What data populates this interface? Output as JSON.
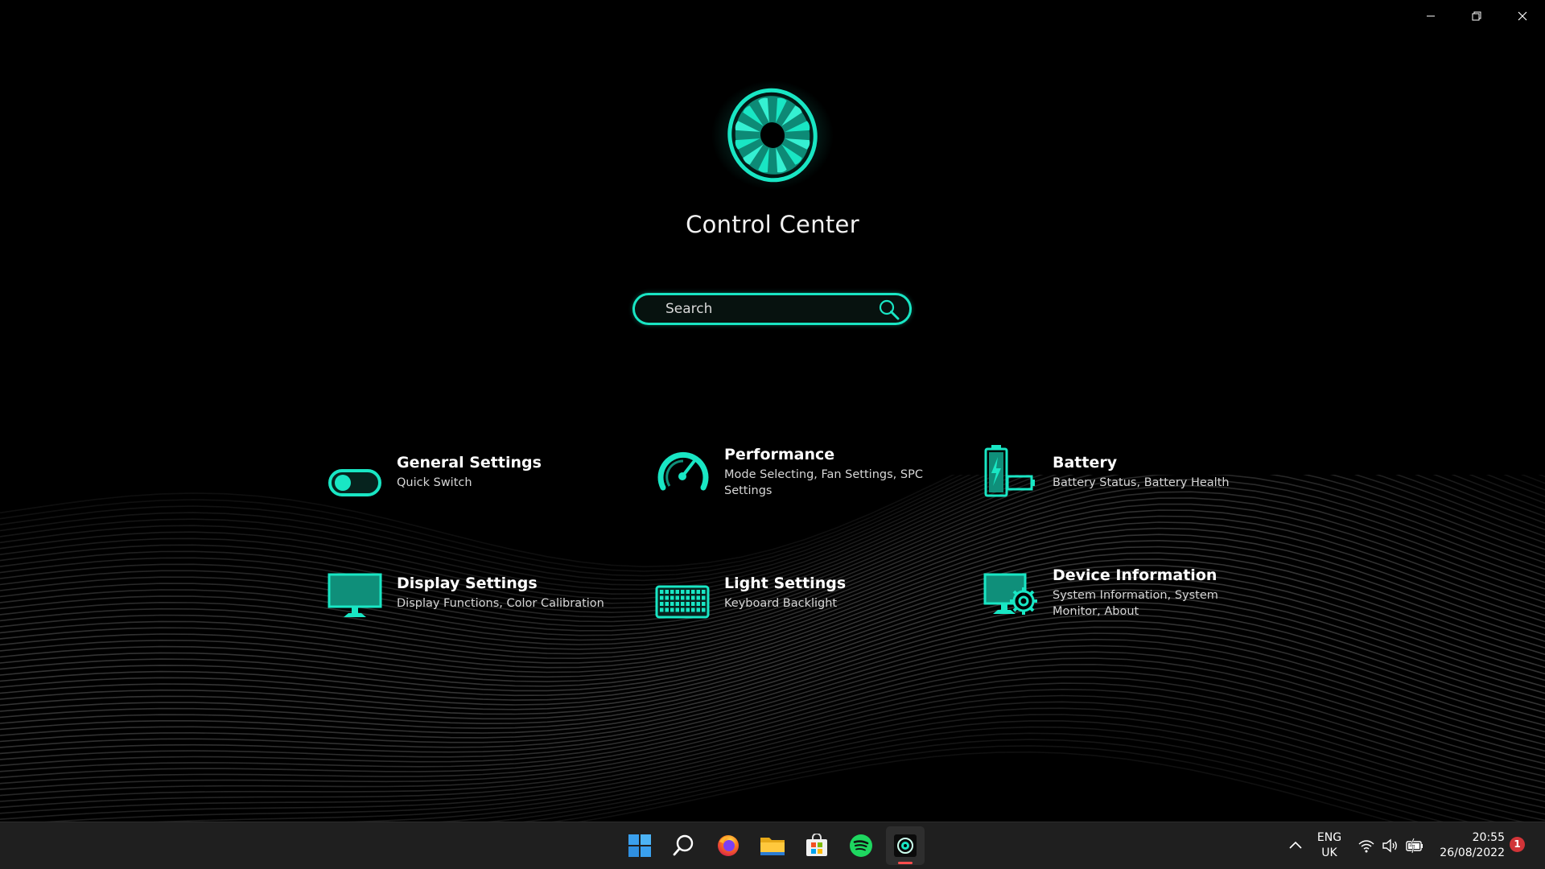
{
  "app": {
    "title": "Control Center",
    "accent_color": "#19e6c4",
    "logo_icon": "fan-icon"
  },
  "window_controls": {
    "minimize_icon": "minimize-icon",
    "restore_icon": "restore-icon",
    "close_icon": "close-icon"
  },
  "search": {
    "placeholder": "Search",
    "value": "",
    "icon": "search-icon"
  },
  "tiles": [
    {
      "id": "general-settings",
      "title": "General Settings",
      "subtitle": "Quick Switch",
      "icon": "toggle-switch-icon"
    },
    {
      "id": "performance",
      "title": "Performance",
      "subtitle": "Mode Selecting, Fan Settings, SPC Settings",
      "icon": "speedometer-icon"
    },
    {
      "id": "battery",
      "title": "Battery",
      "subtitle": "Battery Status, Battery Health",
      "icon": "battery-icon"
    },
    {
      "id": "display-settings",
      "title": "Display Settings",
      "subtitle": "Display Functions, Color Calibration",
      "icon": "monitor-icon"
    },
    {
      "id": "light-settings",
      "title": "Light Settings",
      "subtitle": "Keyboard Backlight",
      "icon": "keyboard-icon"
    },
    {
      "id": "device-information",
      "title": "Device Information",
      "subtitle": "System Information, System Monitor, About",
      "icon": "monitor-gear-icon"
    }
  ],
  "taskbar": {
    "apps": [
      {
        "name": "Start",
        "icon": "windows-start-icon",
        "active": false
      },
      {
        "name": "Search",
        "icon": "search-icon",
        "active": false
      },
      {
        "name": "Firefox",
        "icon": "firefox-icon",
        "active": false
      },
      {
        "name": "File Explorer",
        "icon": "folder-icon",
        "active": false
      },
      {
        "name": "Microsoft Store",
        "icon": "store-icon",
        "active": false
      },
      {
        "name": "Spotify",
        "icon": "spotify-icon",
        "active": false
      },
      {
        "name": "Control Center",
        "icon": "control-center-icon",
        "active": true
      }
    ],
    "tray": {
      "chevron_icon": "chevron-up-icon",
      "language_line1": "ENG",
      "language_line2": "UK",
      "wifi_icon": "wifi-icon",
      "volume_icon": "volume-icon",
      "battery_icon": "battery-charging-icon",
      "time": "20:55",
      "date": "26/08/2022",
      "notification_count": "1"
    }
  }
}
